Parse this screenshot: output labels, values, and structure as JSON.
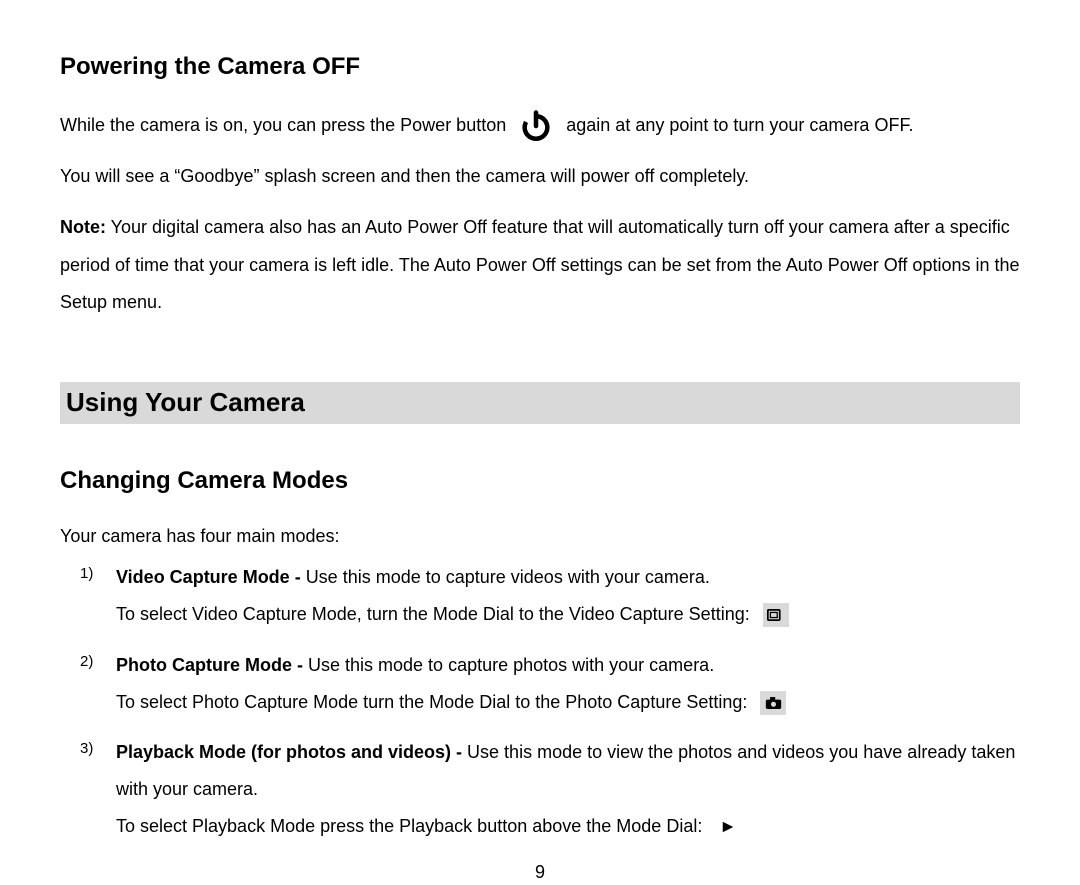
{
  "section1": {
    "title": "Powering the Camera OFF",
    "line1a": "While the camera is on, you can press the Power button",
    "line1b": "again at any point to turn your camera OFF.",
    "line2": "You will see a “Goodbye” splash screen and then the camera will power off completely.",
    "note_label": "Note:",
    "note_text": " Your digital camera also has an Auto Power Off feature that will automatically turn off your camera after a specific period of time that your camera is left idle. The Auto Power Off settings can be set from the Auto Power Off options in the Setup menu."
  },
  "section2": {
    "banner": "Using Your Camera",
    "subhead": "Changing Camera Modes",
    "intro": "Your camera has four main modes:"
  },
  "modes": [
    {
      "title": "Video Capture Mode - ",
      "desc": "Use this mode to capture videos with your camera.",
      "instr": "To select Video Capture Mode, turn the Mode Dial to the Video Capture Setting:",
      "icon": "video"
    },
    {
      "title": "Photo Capture Mode - ",
      "desc": "Use this mode to capture photos with your camera.",
      "instr": "To select Photo Capture Mode turn the Mode Dial to the Photo Capture Setting:",
      "icon": "camera"
    },
    {
      "title": "Playback Mode (for photos and videos) - ",
      "desc": "Use this mode to view the photos and videos you have already taken with your camera.",
      "instr": "To select Playback Mode press the Playback button above the Mode Dial:",
      "icon": "play"
    }
  ],
  "page_number": "9"
}
